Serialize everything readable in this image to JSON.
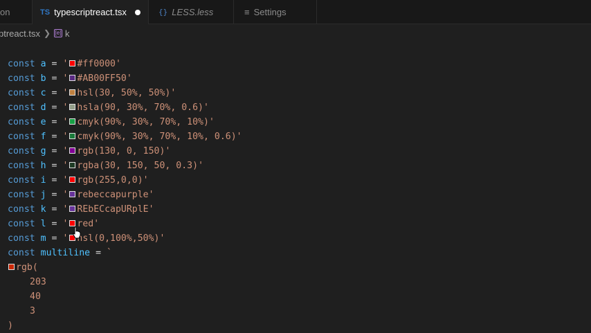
{
  "tabs": [
    {
      "label": "on"
    },
    {
      "icon_text": "TS",
      "label": "typescriptreact.tsx",
      "dirty": true
    },
    {
      "icon_text": "{}",
      "label": "LESS.less"
    },
    {
      "icon_text": "≡",
      "label": "Settings"
    }
  ],
  "breadcrumb": {
    "file": "ptreact.tsx",
    "symbol_icon": "[e]",
    "symbol": "k"
  },
  "code": {
    "keyword": "const",
    "lines": [
      {
        "name": "a",
        "value": "#ff0000",
        "color": "#ff0000"
      },
      {
        "name": "b",
        "value": "#AB00FF50",
        "color": "#5a2a82"
      },
      {
        "name": "c",
        "value": "hsl(30, 50%, 50%)",
        "color": "#bf8040"
      },
      {
        "name": "d",
        "value": "hsla(90, 30%, 70%, 0.6)",
        "color": "#939e89"
      },
      {
        "name": "e",
        "value": "cmyk(90%, 30%, 70%, 10%)",
        "color": "#17a045"
      },
      {
        "name": "f",
        "value": "cmyk(90%, 30%, 70%, 10%, 0.6)",
        "color": "#1a7a3b"
      },
      {
        "name": "g",
        "value": "rgb(130, 0, 150)",
        "color": "#820096"
      },
      {
        "name": "h",
        "value": "rgba(30, 150, 50, 0.3)",
        "color": "#1e3b25"
      },
      {
        "name": "i",
        "value": "rgb(255,0,0)",
        "color": "#ff0000"
      },
      {
        "name": "j",
        "value": "rebeccapurple",
        "color": "#663399"
      },
      {
        "name": "k",
        "value": "REbECcapURplE",
        "color": "#663399"
      },
      {
        "name": "l",
        "value": "red",
        "color": "#ff0000"
      },
      {
        "name": "m",
        "value": "hsl(0,100%,50%)",
        "color": "#ff0000"
      }
    ],
    "multiline": {
      "name": "multiline",
      "func": "rgb(",
      "args": [
        "203",
        "40",
        "3"
      ],
      "close": ")",
      "color": "#cb2803"
    }
  },
  "icons": {
    "cursor": "hand-pointer-icon"
  }
}
